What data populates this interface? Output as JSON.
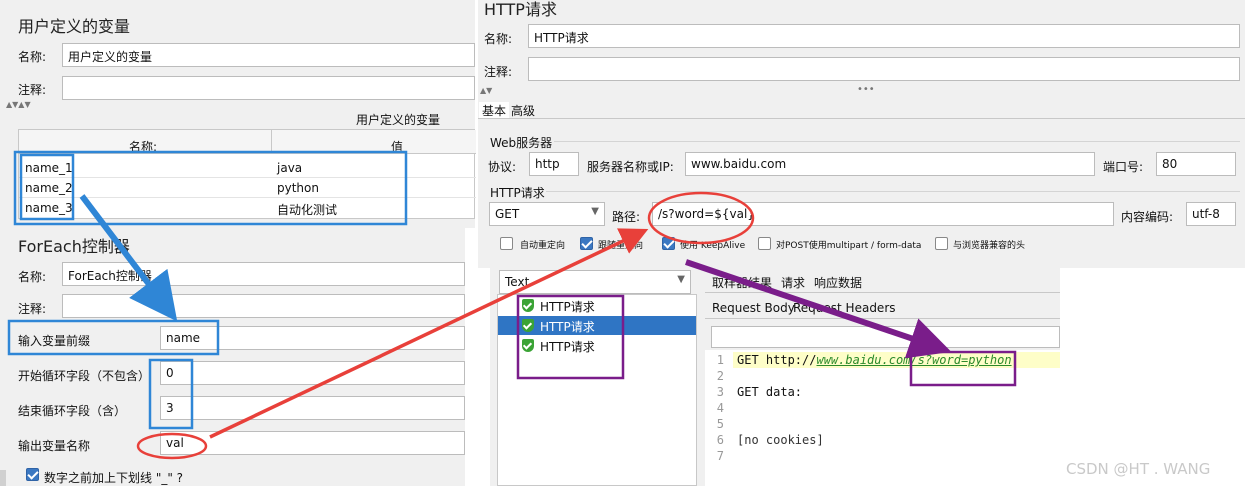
{
  "udv": {
    "title": "用户定义的变量",
    "name_label": "名称:",
    "name_value": "用户定义的变量",
    "comment_label": "注释:",
    "table_caption": "用户定义的变量",
    "col_name": "名称:",
    "col_value": "值",
    "rows": [
      {
        "name": "name_1",
        "value": "java"
      },
      {
        "name": "name_2",
        "value": "python"
      },
      {
        "name": "name_3",
        "value": "自动化测试"
      }
    ]
  },
  "foreach": {
    "title": "ForEach控制器",
    "name_label": "名称:",
    "name_value": "ForEach控制器",
    "comment_label": "注释:",
    "prefix_label": "输入变量前缀",
    "prefix_value": "name",
    "start_label": "开始循环字段（不包含）",
    "start_value": "0",
    "end_label": "结束循环字段（含）",
    "end_value": "3",
    "output_label": "输出变量名称",
    "output_value": "val",
    "underscore_label": "数字之前加上下划线 \"_\" ?"
  },
  "http": {
    "title": "HTTP请求",
    "name_label": "名称:",
    "name_value": "HTTP请求",
    "comment_label": "注释:",
    "tabs": [
      "基本",
      "高级"
    ],
    "web_server_title": "Web服务器",
    "protocol_label": "协议:",
    "protocol_value": "http",
    "server_label": "服务器名称或IP:",
    "server_value": "www.baidu.com",
    "port_label": "端口号:",
    "port_value": "80",
    "http_request_title": "HTTP请求",
    "method_value": "GET",
    "path_label": "路径:",
    "path_value": "/s?word=${val}",
    "encoding_label": "内容编码:",
    "encoding_value": "utf-8",
    "options": [
      {
        "label": "自动重定向",
        "checked": false
      },
      {
        "label": "跟随重定向",
        "checked": true
      },
      {
        "label": "使用 KeepAlive",
        "checked": true
      },
      {
        "label": "对POST使用multipart / form-data",
        "checked": false
      },
      {
        "label": "与浏览器兼容的头",
        "checked": false
      }
    ]
  },
  "results": {
    "renderer_value": "Text",
    "tree_items": [
      "HTTP请求",
      "HTTP请求",
      "HTTP请求"
    ],
    "tabs": [
      "取样器结果",
      "请求",
      "响应数据"
    ],
    "subtabs": [
      "Request Body",
      "Request Headers"
    ],
    "code_lines": [
      {
        "n": "1",
        "text": "GET http://"
      },
      {
        "n": "2",
        "text": ""
      },
      {
        "n": "3",
        "text": "GET data:"
      },
      {
        "n": "4",
        "text": ""
      },
      {
        "n": "5",
        "text": ""
      },
      {
        "n": "6",
        "text": "[no cookies]"
      },
      {
        "n": "7",
        "text": ""
      }
    ],
    "url_link": "www.baidu.com/s?word=python"
  },
  "watermark": "CSDN @HT . WANG",
  "colors": {
    "panel_bg": "#f0f0f0",
    "highlight_blue": "#2f86d6",
    "annotation_red": "#e8403a",
    "annotation_purple": "#7a1d8a",
    "selected_row": "#2f75c4",
    "code_highlight": "#fefec8"
  }
}
